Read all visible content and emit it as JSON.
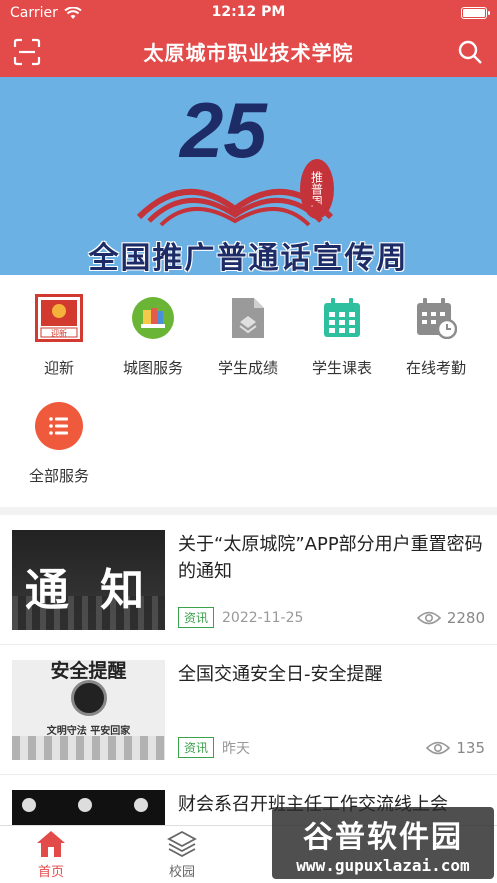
{
  "status_bar": {
    "carrier": "Carrier",
    "time": "12:12 PM"
  },
  "header": {
    "title": "太原城市职业技术学院"
  },
  "banner": {
    "number": "25",
    "seal_text": "推普周",
    "caption": "全国推广普通话宣传周"
  },
  "services": [
    {
      "label": "迎新",
      "icon": "welcome-icon",
      "icon_text": "迎新"
    },
    {
      "label": "城图服务",
      "icon": "library-icon"
    },
    {
      "label": "学生成绩",
      "icon": "grades-icon"
    },
    {
      "label": "学生课表",
      "icon": "timetable-icon"
    },
    {
      "label": "在线考勤",
      "icon": "attendance-icon"
    },
    {
      "label": "全部服务",
      "icon": "all-services-icon"
    }
  ],
  "news": [
    {
      "title": "关于“太原城院”APP部分用户重置密码的通知",
      "tag": "资讯",
      "date": "2022-11-25",
      "views": "2280",
      "thumb_text": "通 知"
    },
    {
      "title": "全国交通安全日-安全提醒",
      "tag": "资讯",
      "date": "昨天",
      "views": "135",
      "thumb_text": "安全提醒",
      "thumb_sub": "文明守法 平安回家"
    },
    {
      "title": "财会系召开班主任工作交流线上会",
      "tag": "",
      "date": "",
      "views": ""
    }
  ],
  "tabbar": [
    {
      "label": "首页",
      "icon": "home-icon",
      "active": true
    },
    {
      "label": "校园",
      "icon": "campus-layers-icon",
      "active": false
    }
  ],
  "watermark": {
    "title": "谷普软件园",
    "url": "www.gupuxlazai.com"
  },
  "colors": {
    "primary": "#e34a4a",
    "banner_bg": "#6cb1e4",
    "tag_green": "#3aa24a"
  }
}
